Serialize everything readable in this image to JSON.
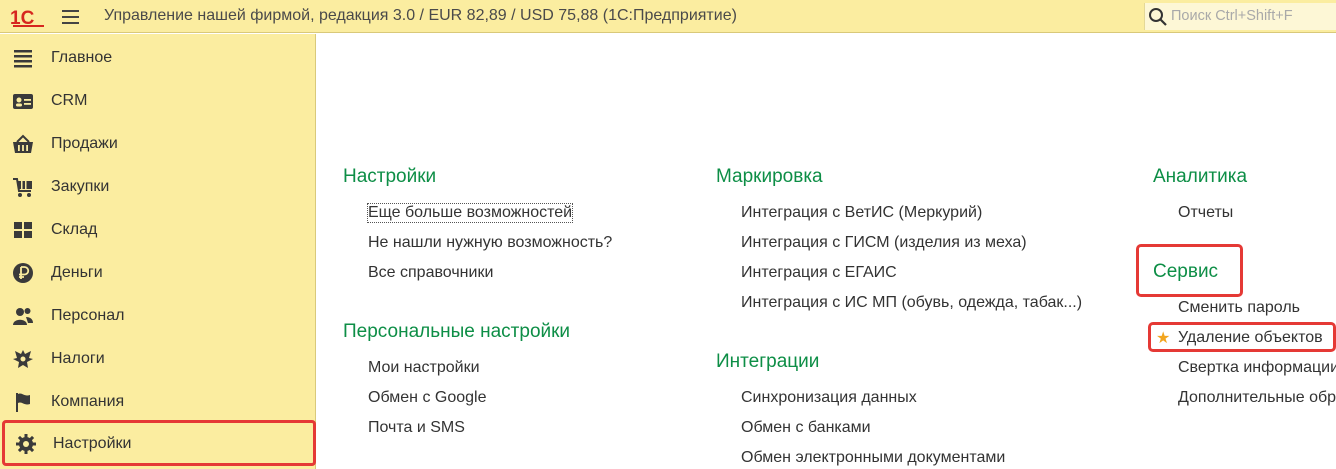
{
  "topbar": {
    "logo_text": "1С",
    "title": "Управление нашей фирмой, редакция 3.0 / EUR 82,89 / USD 75,88  (1С:Предприятие)",
    "search_placeholder": "Поиск Ctrl+Shift+F"
  },
  "sidebar": {
    "items": [
      {
        "label": "Главное",
        "icon": "list-icon"
      },
      {
        "label": "CRM",
        "icon": "contact-card-icon"
      },
      {
        "label": "Продажи",
        "icon": "basket-icon"
      },
      {
        "label": "Закупки",
        "icon": "cart-icon"
      },
      {
        "label": "Склад",
        "icon": "grid-icon"
      },
      {
        "label": "Деньги",
        "icon": "ruble-icon"
      },
      {
        "label": "Персонал",
        "icon": "people-icon"
      },
      {
        "label": "Налоги",
        "icon": "eagle-icon"
      },
      {
        "label": "Компания",
        "icon": "flag-icon"
      },
      {
        "label": "Настройки",
        "icon": "gear-icon",
        "active": true
      }
    ]
  },
  "content": {
    "col1": {
      "settings": {
        "title": "Настройки",
        "links": [
          "Еще больше возможностей",
          "Не нашли нужную возможность?",
          "Все справочники"
        ]
      },
      "personal": {
        "title": "Персональные настройки",
        "links": [
          "Мои настройки",
          "Обмен с Google",
          "Почта и SMS"
        ]
      }
    },
    "col2": {
      "marking": {
        "title": "Маркировка",
        "links": [
          "Интеграция с ВетИС (Меркурий)",
          "Интеграция с ГИСМ (изделия из меха)",
          "Интеграция с ЕГАИС",
          "Интеграция с ИС МП (обувь, одежда, табак...)"
        ]
      },
      "integrations": {
        "title": "Интеграции",
        "links": [
          "Синхронизация данных",
          "Обмен с банками",
          "Обмен электронными документами"
        ]
      }
    },
    "col3": {
      "analytics": {
        "title": "Аналитика",
        "links": [
          "Отчеты"
        ]
      },
      "service": {
        "title": "Сервис",
        "links": [
          "Сменить пароль",
          "Удаление объектов",
          "Свертка информации",
          "Дополнительные обработки"
        ]
      }
    }
  },
  "colors": {
    "panel": "#fbeda0",
    "section_title": "#0d8e46",
    "highlight": "#e53935",
    "star": "#f2a51f"
  }
}
